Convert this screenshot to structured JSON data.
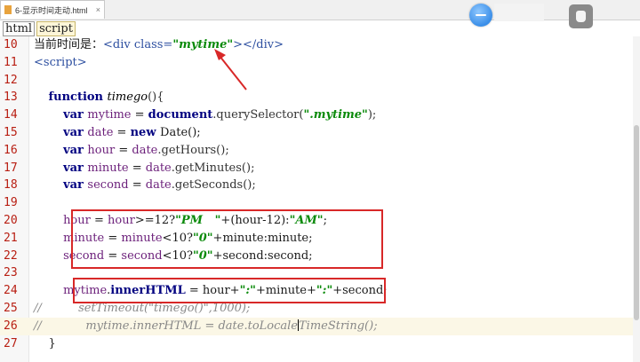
{
  "tab": {
    "filename": "6-显示时间走动.html",
    "close": "×"
  },
  "breadcrumbs": [
    "html",
    "script"
  ],
  "colors": {
    "annotation": "#d82828",
    "line_number": "#b81e12",
    "keyword": "#000080",
    "string": "#0a8a0a"
  },
  "icons": {
    "floating_ball": "assistant-ball-icon",
    "floating_app": "app-icon"
  },
  "editor": {
    "current_line": 26,
    "lines": [
      {
        "n": "10",
        "tokens": [
          {
            "t": "当前时间是：",
            "c": ""
          },
          {
            "t": "<div ",
            "c": "tag"
          },
          {
            "t": "class=",
            "c": "tag"
          },
          {
            "t": "\"mytime\"",
            "c": "str"
          },
          {
            "t": "></div>",
            "c": "tag"
          }
        ]
      },
      {
        "n": "11",
        "tokens": [
          {
            "t": "<script>",
            "c": "tag"
          }
        ]
      },
      {
        "n": "12",
        "tokens": []
      },
      {
        "n": "13",
        "tokens": [
          {
            "t": "    "
          },
          {
            "t": "function ",
            "c": "kw"
          },
          {
            "t": "timego",
            "c": "fn"
          },
          {
            "t": "(){",
            "c": "op"
          }
        ]
      },
      {
        "n": "14",
        "tokens": [
          {
            "t": "        "
          },
          {
            "t": "var ",
            "c": "kw"
          },
          {
            "t": "mytime",
            "c": "var"
          },
          {
            "t": " = "
          },
          {
            "t": "document",
            "c": "kw"
          },
          {
            "t": ".querySelector(",
            "c": "op"
          },
          {
            "t": "\".mytime\"",
            "c": "str"
          },
          {
            "t": ");",
            "c": "op"
          }
        ]
      },
      {
        "n": "15",
        "tokens": [
          {
            "t": "        "
          },
          {
            "t": "var ",
            "c": "kw"
          },
          {
            "t": "date",
            "c": "var"
          },
          {
            "t": " = "
          },
          {
            "t": "new ",
            "c": "kw"
          },
          {
            "t": "Date();"
          }
        ]
      },
      {
        "n": "16",
        "tokens": [
          {
            "t": "        "
          },
          {
            "t": "var ",
            "c": "kw"
          },
          {
            "t": "hour",
            "c": "var"
          },
          {
            "t": " = "
          },
          {
            "t": "date",
            "c": "var"
          },
          {
            "t": ".getHours();",
            "c": "op"
          }
        ]
      },
      {
        "n": "17",
        "tokens": [
          {
            "t": "        "
          },
          {
            "t": "var ",
            "c": "kw"
          },
          {
            "t": "minute",
            "c": "var"
          },
          {
            "t": " = "
          },
          {
            "t": "date",
            "c": "var"
          },
          {
            "t": ".getMinutes();",
            "c": "op"
          }
        ]
      },
      {
        "n": "18",
        "tokens": [
          {
            "t": "        "
          },
          {
            "t": "var ",
            "c": "kw"
          },
          {
            "t": "second",
            "c": "var"
          },
          {
            "t": " = "
          },
          {
            "t": "date",
            "c": "var"
          },
          {
            "t": ".getSeconds();",
            "c": "op"
          }
        ]
      },
      {
        "n": "19",
        "tokens": []
      },
      {
        "n": "20",
        "tokens": [
          {
            "t": "        "
          },
          {
            "t": "hour",
            "c": "var"
          },
          {
            "t": " = "
          },
          {
            "t": "hour",
            "c": "var"
          },
          {
            "t": ">=12?"
          },
          {
            "t": "\"PM   \"",
            "c": "str"
          },
          {
            "t": "+(hour-12):"
          },
          {
            "t": "\"AM\"",
            "c": "str"
          },
          {
            "t": ";"
          }
        ]
      },
      {
        "n": "21",
        "tokens": [
          {
            "t": "        "
          },
          {
            "t": "minute",
            "c": "var"
          },
          {
            "t": " = "
          },
          {
            "t": "minute",
            "c": "var"
          },
          {
            "t": "<10?"
          },
          {
            "t": "\"0\"",
            "c": "str"
          },
          {
            "t": "+minute:minute;"
          }
        ]
      },
      {
        "n": "22",
        "tokens": [
          {
            "t": "        "
          },
          {
            "t": "second",
            "c": "var"
          },
          {
            "t": " = "
          },
          {
            "t": "second",
            "c": "var"
          },
          {
            "t": "<10?"
          },
          {
            "t": "\"0\"",
            "c": "str"
          },
          {
            "t": "+second:second;"
          }
        ]
      },
      {
        "n": "23",
        "tokens": []
      },
      {
        "n": "24",
        "tokens": [
          {
            "t": "        "
          },
          {
            "t": "mytime",
            "c": "var"
          },
          {
            "t": "."
          },
          {
            "t": "innerHTML",
            "c": "kw"
          },
          {
            "t": " = hour+"
          },
          {
            "t": "\":\"",
            "c": "str"
          },
          {
            "t": "+minute+"
          },
          {
            "t": "\":\"",
            "c": "str"
          },
          {
            "t": "+second;"
          }
        ]
      },
      {
        "n": "25",
        "tokens": [
          {
            "t": "//",
            "c": "cmt"
          },
          {
            "t": "          setTimeout(\"timego()\",1000);",
            "c": "cmt"
          }
        ]
      },
      {
        "n": "26",
        "tokens": [
          {
            "t": "//",
            "c": "cmt"
          },
          {
            "t": "            mytime.innerHTML = date.toLocale",
            "c": "cmt"
          },
          {
            "t": "|",
            "c": "cursor"
          },
          {
            "t": "TimeString();",
            "c": "cmt"
          }
        ]
      },
      {
        "n": "27",
        "tokens": [
          {
            "t": "    }"
          }
        ]
      }
    ]
  }
}
